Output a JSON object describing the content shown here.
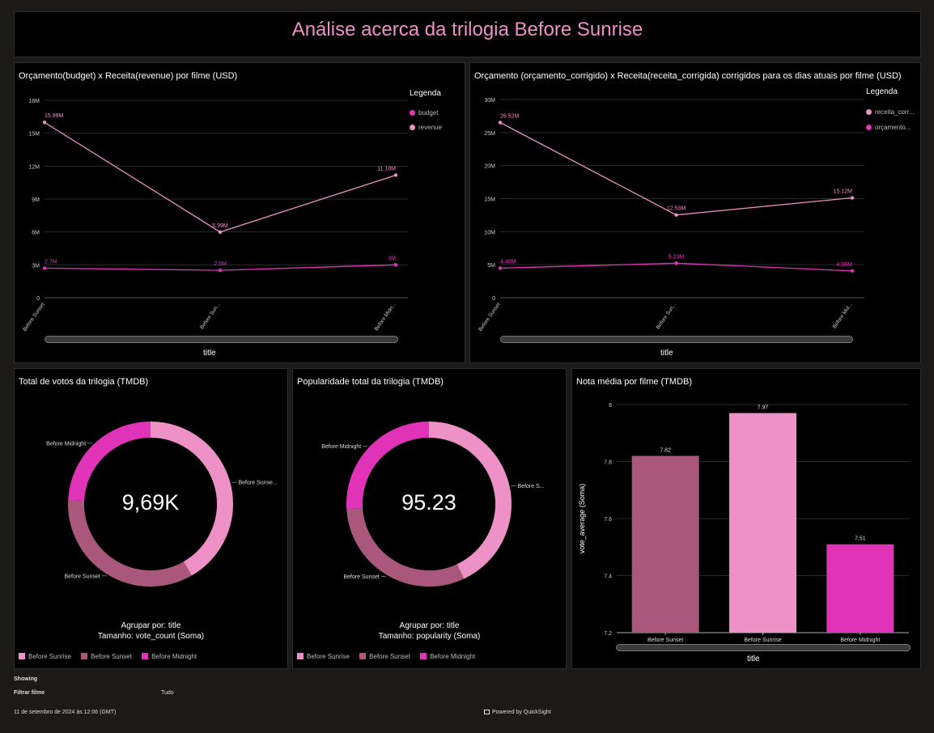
{
  "dashboard": {
    "title": "Análise acerca da trilogia Before Sunrise",
    "colors": {
      "sunrise": "#ee91c6",
      "sunset": "#a9587c",
      "midnight": "#e033b8",
      "budget": "#e033b8",
      "revenue": "#ee91c6"
    }
  },
  "line1": {
    "title": "Orçamento(budget) x Receita(revenue) por filme (USD)",
    "legend_title": "Legenda",
    "legend": [
      "budget",
      "revenue"
    ],
    "x_axis_title": "title",
    "x_ticks": [
      "Before Sunset",
      "Before Sun...",
      "Before Midn..."
    ],
    "y_ticks": [
      "0",
      "3M",
      "6M",
      "9M",
      "12M",
      "15M",
      "18M"
    ]
  },
  "line2": {
    "title": "Orçamento (orçamento_corrigido) x Receita(receita_corrigida) corrigidos para os dias atuais por filme (USD)",
    "legend_title": "Legenda",
    "legend": [
      "receita_corr...",
      "orçamento..."
    ],
    "x_axis_title": "title",
    "x_ticks": [
      "Before Sunset",
      "Before Sun...",
      "Before Mid..."
    ],
    "y_ticks": [
      "0",
      "5M",
      "10M",
      "15M",
      "20M",
      "25M",
      "30M"
    ]
  },
  "donut1": {
    "title": "Total de votos da trilogia (TMDB)",
    "center_value": "9,69K",
    "group_by": "Agrupar por: title",
    "size_by": "Tamanho: vote_count (Soma)",
    "slice_labels": [
      "Before Sunse...",
      "Before Sunset",
      "Before Midnight"
    ],
    "legend": [
      "Before Sunrise",
      "Before Sunset",
      "Before Midnight"
    ]
  },
  "donut2": {
    "title": "Popularidade total da trilogia (TMDB)",
    "center_value": "95.23",
    "group_by": "Agrupar por: title",
    "size_by": "Tamanho: popularity (Soma)",
    "slice_labels": [
      "Before S...",
      "Before Sunset",
      "Before Midnight"
    ],
    "legend": [
      "Before Sunrise",
      "Before Sunset",
      "Before Midnight"
    ]
  },
  "bar": {
    "title": "Nota média por filme (TMDB)",
    "y_axis_title": "vote_average (Soma)",
    "x_axis_title": "title",
    "y_ticks": [
      "7.2",
      "7.4",
      "7.6",
      "7.8",
      "8"
    ]
  },
  "footer": {
    "showing": "Showing",
    "filter_label": "Filtrar filme",
    "filter_value": "Tudo",
    "timestamp": "11 de setembro de 2024 às 12:06 (GMT)",
    "powered": "Powered by QuickSight"
  },
  "chart_data": [
    {
      "type": "line",
      "title": "Orçamento(budget) x Receita(revenue) por filme (USD)",
      "categories": [
        "Before Sunset",
        "Before Sunrise",
        "Before Midnight"
      ],
      "series": [
        {
          "name": "budget",
          "values": [
            2.7,
            2.5,
            3.0
          ],
          "labels": [
            "2.7M",
            "2.5M",
            "3M"
          ]
        },
        {
          "name": "revenue",
          "values": [
            15.99,
            5.99,
            11.18
          ],
          "labels": [
            "15.99M",
            "5.99M",
            "11.18M"
          ]
        }
      ],
      "xlabel": "title",
      "ylim": [
        0,
        18
      ],
      "y_unit": "M"
    },
    {
      "type": "line",
      "title": "Orçamento (orçamento_corrigido) x Receita(receita_corrigida) corrigidos para os dias atuais por filme (USD)",
      "categories": [
        "Before Sunset",
        "Before Sunrise",
        "Before Midnight"
      ],
      "series": [
        {
          "name": "receita_corrigida",
          "values": [
            26.52,
            12.53,
            15.12
          ],
          "labels": [
            "26.52M",
            "12.53M",
            "15.12M"
          ]
        },
        {
          "name": "orçamento_corrigido",
          "values": [
            4.48,
            5.23,
            4.06
          ],
          "labels": [
            "4.48M",
            "5.23M",
            "4.06M"
          ]
        }
      ],
      "xlabel": "title",
      "ylim": [
        0,
        30
      ],
      "y_unit": "M"
    },
    {
      "type": "pie",
      "title": "Total de votos da trilogia (TMDB)",
      "categories": [
        "Before Sunrise",
        "Before Sunset",
        "Before Midnight"
      ],
      "values": [
        4040,
        3300,
        2350
      ]
    },
    {
      "type": "pie",
      "title": "Popularidade total da trilogia (TMDB)",
      "categories": [
        "Before Sunrise",
        "Before Sunset",
        "Before Midnight"
      ],
      "values": [
        41.0,
        29.5,
        24.73
      ]
    },
    {
      "type": "bar",
      "title": "Nota média por filme (TMDB)",
      "categories": [
        "Before Sunset",
        "Before Sunrise",
        "Before Midnight"
      ],
      "values": [
        7.82,
        7.97,
        7.51
      ],
      "labels": [
        "7.82",
        "7.97",
        "7.51"
      ],
      "xlabel": "title",
      "ylabel": "vote_average (Soma)",
      "ylim": [
        7.2,
        8.0
      ]
    }
  ]
}
